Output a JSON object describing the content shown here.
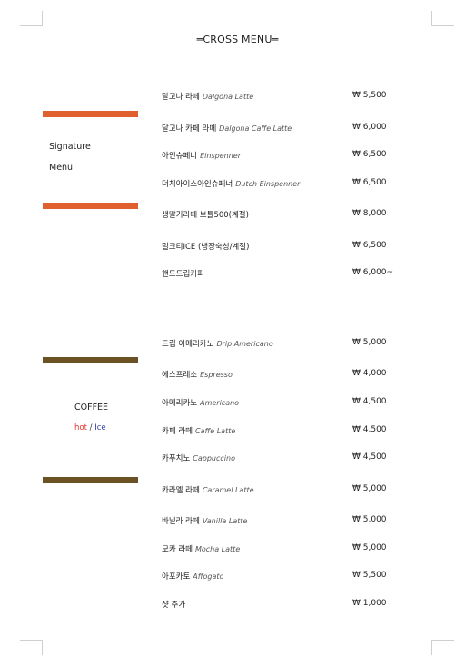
{
  "title": "═CROSS MENU═",
  "signature_section": {
    "label_line1": "Signature",
    "label_line2": "Menu",
    "accent_color": "#e0602d",
    "items": [
      {
        "name_ko": "달고나 라떼",
        "name_en": "Dalgona Latte",
        "price": "₩ 5,500"
      },
      {
        "name_ko": "달고나 카페 라떼",
        "name_en": "Dalgona Caffe Latte",
        "price": "₩ 6,000"
      },
      {
        "name_ko": "아인슈페너",
        "name_en": "Einspenner",
        "price": "₩ 6,500"
      },
      {
        "name_ko": "더치아이스아인슈페너",
        "name_en": "Dutch Einspenner",
        "price": "₩ 6,500"
      },
      {
        "name_ko": "생딸기라떼 보틀500(계절)",
        "name_en": "",
        "price": "₩ 8,000"
      },
      {
        "name_ko": "밀크티ICE (냉장숙성/계절)",
        "name_en": "",
        "price": "₩ 6,500"
      },
      {
        "name_ko": "핸드드립커피",
        "name_en": "",
        "price": "₩ 6,000~"
      }
    ]
  },
  "coffee_section": {
    "label": "COFFEE",
    "hot_label": "hot",
    "separator": "/",
    "ice_label": "Ice",
    "accent_color": "#6b5225",
    "hot_color": "#e2322a",
    "ice_color": "#2c3ea8",
    "items": [
      {
        "name_ko": "드립 아메리카노",
        "name_en": "Drip Americano",
        "price": "₩ 5,000"
      },
      {
        "name_ko": "에스프레소",
        "name_en": "Espresso",
        "price": "₩ 4,000"
      },
      {
        "name_ko": "아메리카노",
        "name_en": "Americano",
        "price": "₩ 4,500"
      },
      {
        "name_ko": "카페 라떼",
        "name_en": "Caffe Latte",
        "price": "₩ 4,500"
      },
      {
        "name_ko": "카푸치노",
        "name_en": "Cappuccino",
        "price": "₩ 4,500"
      },
      {
        "name_ko": "카라멜 라떼",
        "name_en": "Caramel Latte",
        "price": "₩ 5,000"
      },
      {
        "name_ko": "바닐라 라떼",
        "name_en": "Vanilla Latte",
        "price": "₩ 5,000"
      },
      {
        "name_ko": "모카 라떼",
        "name_en": "Mocha Latte",
        "price": "₩ 5,000"
      },
      {
        "name_ko": "아포카토",
        "name_en": "Affogato",
        "price": "₩ 5,500"
      },
      {
        "name_ko": "샷 추가",
        "name_en": "",
        "price": "₩ 1,000"
      }
    ]
  }
}
